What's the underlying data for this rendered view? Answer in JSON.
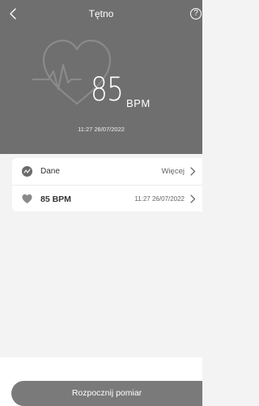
{
  "header": {
    "title": "Tętno",
    "help_label": "?",
    "bpm_value": "85",
    "bpm_unit": "BPM",
    "timestamp": "11:27 26/07/2022"
  },
  "card": {
    "data_row": {
      "label": "Dane",
      "link_label": "Więcej",
      "icon": "chart-icon"
    },
    "record_row": {
      "label": "85 BPM",
      "timestamp": "11:27 26/07/2022",
      "icon": "heart-icon"
    }
  },
  "footer": {
    "start_button_label": "Rozpocznij pomiar"
  },
  "colors": {
    "header_bg": "#6f6f6f",
    "button_bg": "#7a7a7a",
    "page_bg": "#f3f3f3"
  }
}
